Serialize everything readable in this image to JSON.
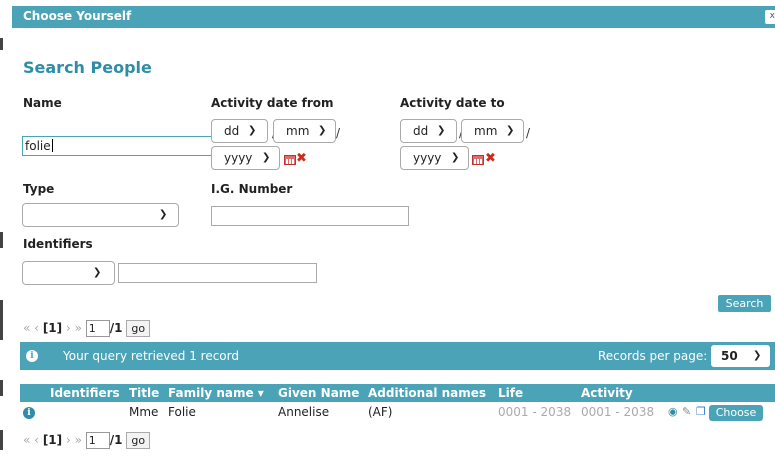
{
  "dialog": {
    "title": "Choose Yourself",
    "close_label": "x"
  },
  "heading": "Search People",
  "labels": {
    "name": "Name",
    "activity_from": "Activity date from",
    "activity_to": "Activity date to",
    "type": "Type",
    "ig_number": "I.G. Number",
    "identifiers": "Identifiers"
  },
  "fields": {
    "name_value": "folie",
    "type_value": "",
    "ig_number_value": "",
    "identifier_type_value": "",
    "identifier_value": ""
  },
  "date_from": {
    "day": "dd",
    "month": "mm",
    "year": "yyyy"
  },
  "date_to": {
    "day": "dd",
    "month": "mm",
    "year": "yyyy"
  },
  "date_separator": "/",
  "search_button": "Search",
  "pager": {
    "first": "«",
    "prev": "‹",
    "current": "[1]",
    "next": "›",
    "last": "»",
    "page_input": "1",
    "total": "/1",
    "go_label": "go"
  },
  "status": {
    "message": "Your query retrieved 1 record",
    "records_label": "Records per page:",
    "records_value": "50"
  },
  "table": {
    "columns": [
      "Identifiers",
      "Title",
      "Family name ▾",
      "Given Name",
      "Additional names",
      "Life",
      "Activity"
    ],
    "rows": [
      {
        "identifiers": "",
        "title": "Mme",
        "family_name": "Folie",
        "given_name": "Annelise",
        "additional_names": "(AF)",
        "life_from": "0001",
        "life_to": "2038",
        "activity_from": "0001",
        "activity_to": "2038",
        "range_sep": "-",
        "choose_label": "Choose"
      }
    ]
  },
  "icons": {
    "info": "info-icon",
    "eye": "eye-icon",
    "edit": "edit-icon",
    "copy": "copy-icon",
    "calendar": "calendar-icon",
    "clear": "clear-icon"
  },
  "colors": {
    "accent": "#4ba3b8",
    "heading": "#2f8ea5",
    "clear": "#cc2a1a"
  }
}
